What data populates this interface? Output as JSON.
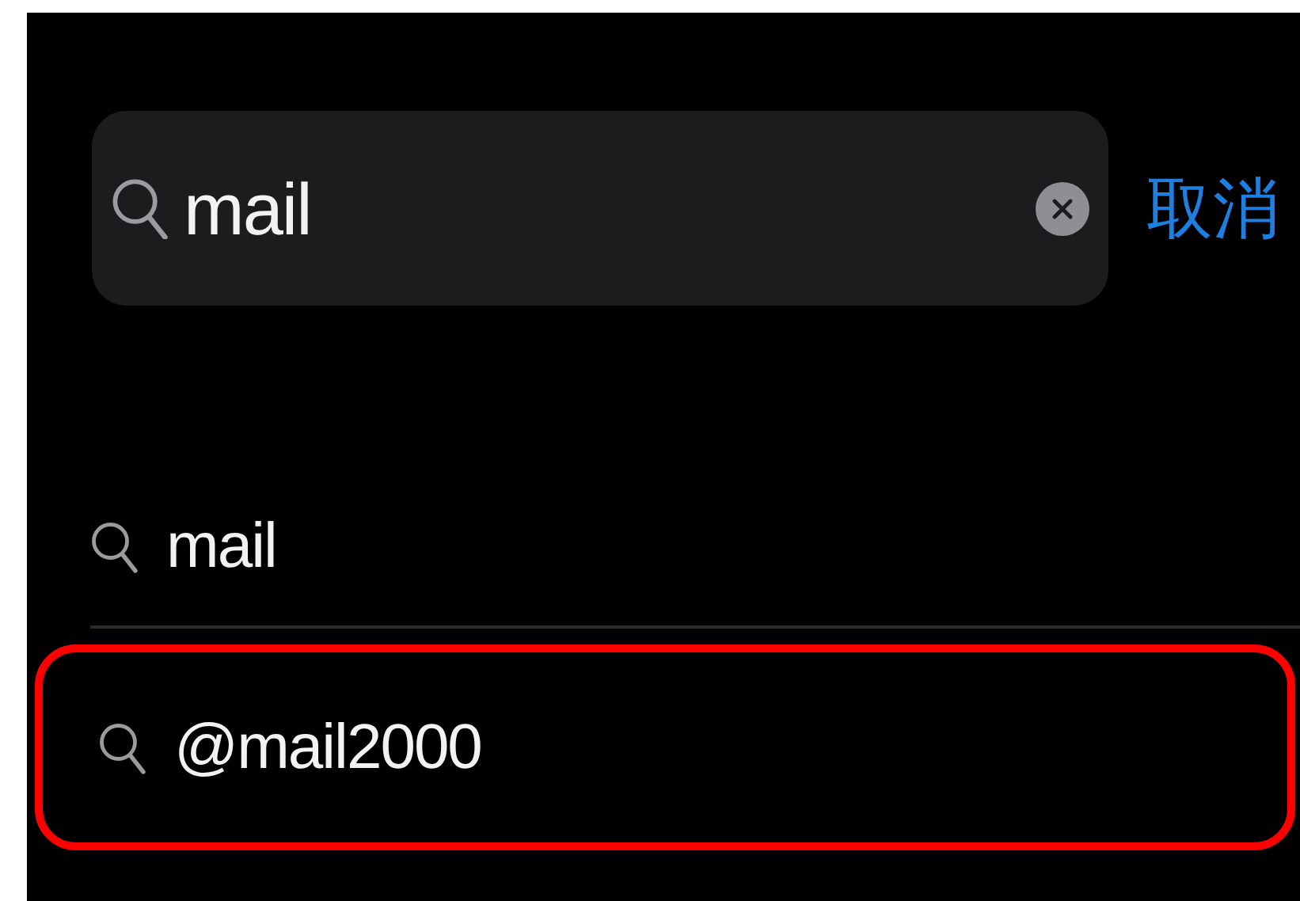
{
  "search": {
    "value": "mail",
    "cancel": "取消"
  },
  "suggestions": [
    {
      "text": "mail",
      "highlighted": false
    },
    {
      "text": "@mail2000",
      "highlighted": true
    }
  ]
}
